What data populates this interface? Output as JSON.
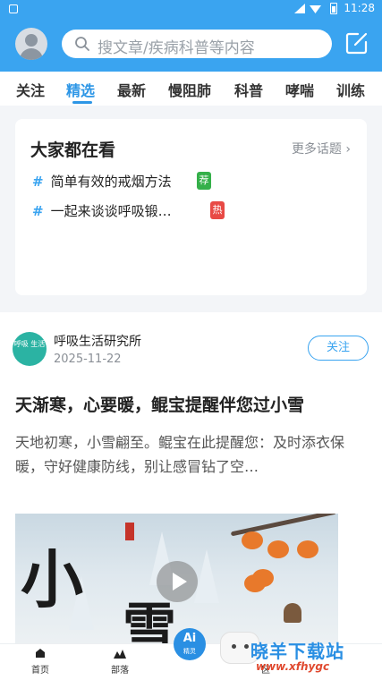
{
  "status_bar": {
    "time": "11:28"
  },
  "header": {
    "search_placeholder": "搜文章/疾病科普等内容"
  },
  "tabs": [
    {
      "label": "关注"
    },
    {
      "label": "精选",
      "active": true
    },
    {
      "label": "最新"
    },
    {
      "label": "慢阻肺"
    },
    {
      "label": "科普"
    },
    {
      "label": "哮喘"
    },
    {
      "label": "训练"
    }
  ],
  "hot_topics": {
    "title": "大家都在看",
    "more": "更多话题 ›",
    "items": [
      {
        "hash": "#",
        "text": "简单有效的戒烟方法",
        "badge": "荐",
        "badge_color": "#35b04a"
      },
      {
        "hash": "#",
        "text": "一起来谈谈呼吸锻…",
        "badge": "热",
        "badge_color": "#e84a45"
      }
    ]
  },
  "post": {
    "publisher_logo": "呼吸 生活",
    "publisher": "呼吸生活研究所",
    "date": "2025-11-22",
    "follow_label": "关注",
    "title": "天渐寒，心要暖，鲲宝提醒伴您过小雪",
    "summary": "天地初寒，小雪翩至。鲲宝在此提醒您：及时添衣保暖，守好健康防线，别让感冒钻了空…",
    "cover_text": [
      "小",
      "雪"
    ]
  },
  "bottom_nav": [
    {
      "label": "首页",
      "icon": "home-icon"
    },
    {
      "label": "部落",
      "icon": "tribe-icon"
    },
    {
      "label": "区",
      "icon": "zone-icon"
    }
  ],
  "ai_button": {
    "label": "Ai",
    "sub": "精灵"
  },
  "watermark": {
    "main": "晓羊下载站",
    "sub": "www.xfhygc"
  },
  "colors": {
    "primary": "#3aa4f0",
    "accent": "#2d96e6",
    "badge_rec": "#35b04a",
    "badge_hot": "#e84a45"
  }
}
